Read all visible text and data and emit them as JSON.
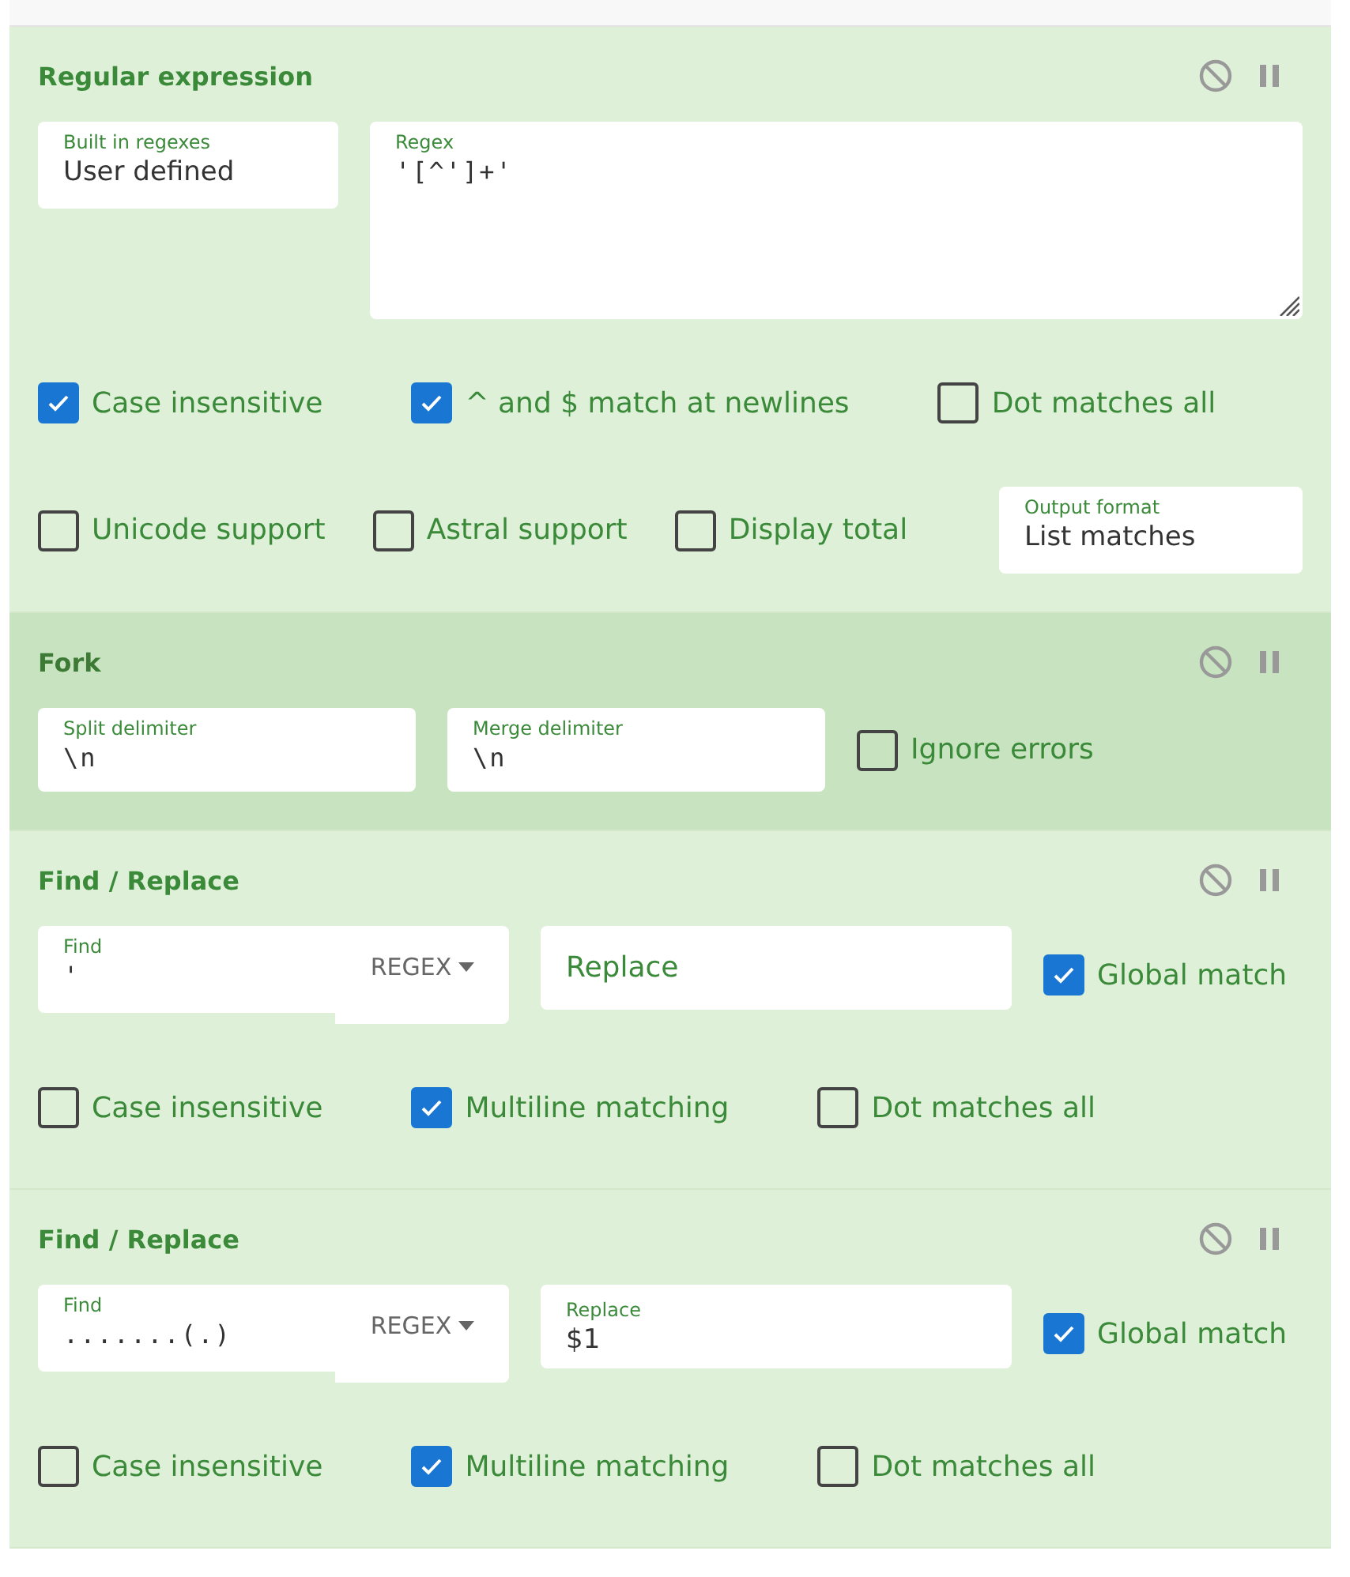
{
  "operations": [
    {
      "title": "Regular expression",
      "highlighted": false,
      "rows": [
        {
          "items": [
            {
              "kind": "select",
              "label": "Built in regexes",
              "value": "User defined"
            },
            {
              "kind": "textarea",
              "label": "Regex",
              "value": "'[^']+'"
            }
          ]
        },
        {
          "items": [
            {
              "kind": "checkbox",
              "label": "Case insensitive",
              "checked": true
            },
            {
              "kind": "checkbox",
              "label": "^ and $ match at newlines",
              "checked": true
            },
            {
              "kind": "checkbox",
              "label": "Dot matches all",
              "checked": false
            }
          ]
        },
        {
          "items": [
            {
              "kind": "checkbox",
              "label": "Unicode support",
              "checked": false
            },
            {
              "kind": "checkbox",
              "label": "Astral support",
              "checked": false
            },
            {
              "kind": "checkbox",
              "label": "Display total",
              "checked": false
            },
            {
              "kind": "select",
              "label": "Output format",
              "value": "List matches"
            }
          ]
        }
      ]
    },
    {
      "title": "Fork",
      "highlighted": true,
      "rows": [
        {
          "items": [
            {
              "kind": "text",
              "label": "Split delimiter",
              "value": "\\n"
            },
            {
              "kind": "text",
              "label": "Merge delimiter",
              "value": "\\n"
            },
            {
              "kind": "checkbox",
              "label": "Ignore errors",
              "checked": false
            }
          ]
        }
      ]
    },
    {
      "title": "Find / Replace",
      "highlighted": false,
      "rows": [
        {
          "items": [
            {
              "kind": "find",
              "label": "Find",
              "value": "'",
              "mode": "REGEX"
            },
            {
              "kind": "replace",
              "placeholder": "Replace"
            },
            {
              "kind": "checkbox",
              "label": "Global match",
              "checked": true
            }
          ]
        },
        {
          "items": [
            {
              "kind": "checkbox",
              "label": "Case insensitive",
              "checked": false
            },
            {
              "kind": "checkbox",
              "label": "Multiline matching",
              "checked": true
            },
            {
              "kind": "checkbox",
              "label": "Dot matches all",
              "checked": false
            }
          ]
        }
      ]
    },
    {
      "title": "Find / Replace",
      "highlighted": false,
      "rows": [
        {
          "items": [
            {
              "kind": "find",
              "label": "Find",
              "value": ".......(.)",
              "mode": "REGEX"
            },
            {
              "kind": "replace",
              "label": "Replace",
              "value": "$1"
            },
            {
              "kind": "checkbox",
              "label": "Global match",
              "checked": true
            }
          ]
        },
        {
          "items": [
            {
              "kind": "checkbox",
              "label": "Case insensitive",
              "checked": false
            },
            {
              "kind": "checkbox",
              "label": "Multiline matching",
              "checked": true
            },
            {
              "kind": "checkbox",
              "label": "Dot matches all",
              "checked": false
            }
          ]
        }
      ]
    }
  ]
}
